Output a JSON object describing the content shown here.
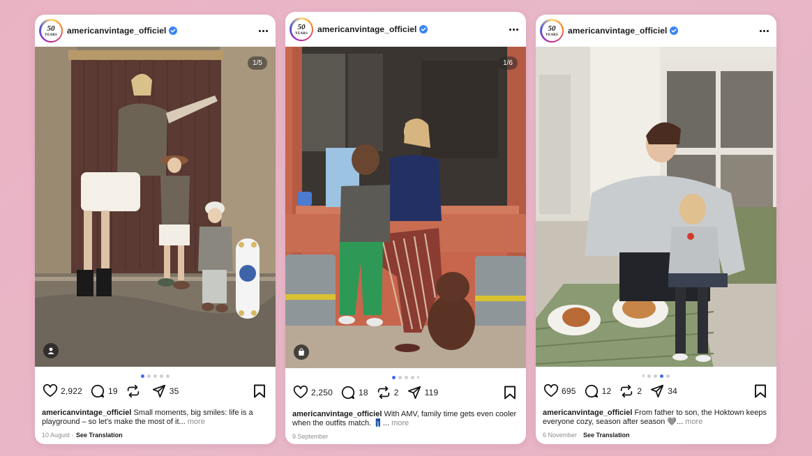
{
  "posts": [
    {
      "username": "americanvintage_officiel",
      "counter": "1/5",
      "dots": 5,
      "active_dot": 0,
      "likes": "2,922",
      "comments": "19",
      "reposts": "",
      "shares": "35",
      "caption_user": "americanvintage_officiel",
      "caption_text": " Small moments, big smiles: life is a playground – so let's make the most of it...",
      "caption_more": " more",
      "date": "10 August",
      "translation": "See Translation",
      "badge_icon": "person-icon"
    },
    {
      "username": "americanvintage_officiel",
      "counter": "1/6",
      "dots": 6,
      "active_dot": 0,
      "likes": "2,250",
      "comments": "18",
      "reposts": "2",
      "shares": "119",
      "caption_user": "americanvintage_officiel",
      "caption_text": " With AMV, family time gets even cooler when the outfits match. 👖...",
      "caption_more": " more",
      "date": "9 September",
      "translation": "",
      "badge_icon": "shopping-bag-icon"
    },
    {
      "username": "americanvintage_officiel",
      "counter": "",
      "dots": 4,
      "active_dot": 3,
      "likes": "695",
      "comments": "12",
      "reposts": "2",
      "shares": "34",
      "caption_user": "americanvintage_officiel",
      "caption_text": " From father to son, the Hoktown keeps everyone cozy, season after season 🩶...",
      "caption_more": " more",
      "date": "6 November",
      "translation": "See Translation",
      "badge_icon": ""
    }
  ],
  "avatar": {
    "number": "50",
    "label": "YEARS",
    "sub": "American Vintage"
  },
  "colors": {
    "accent_dot": "#3f6cf0",
    "verified": "#3b82f6",
    "background": "#e9b6c6"
  }
}
